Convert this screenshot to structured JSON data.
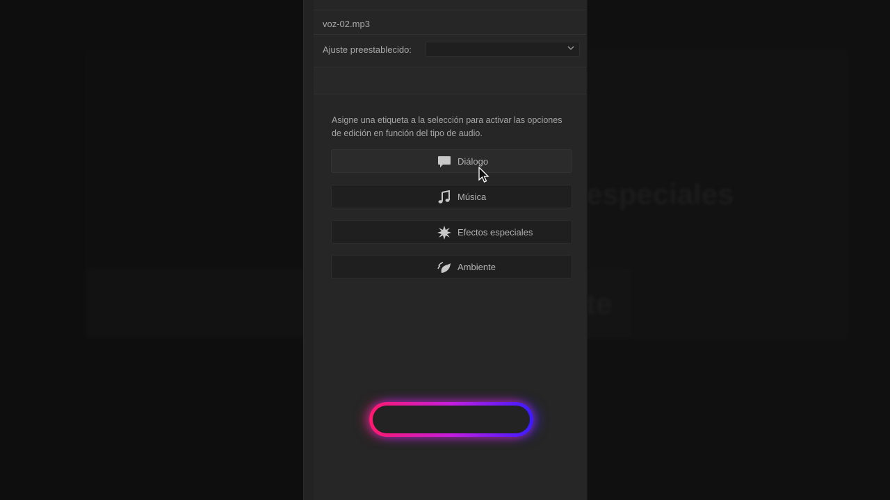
{
  "background": {
    "text_one": "especiales",
    "text_two": "te"
  },
  "panel": {
    "clip_name": "voz-02.mp3",
    "preset_label": "Ajuste preestablecido:",
    "preset_value": "",
    "hint": "Asigne una etiqueta a la selección para activar las opciones de edición en función del tipo de audio.",
    "buttons": [
      {
        "label": "Diálogo",
        "icon": "speech-bubble-icon"
      },
      {
        "label": "Música",
        "icon": "music-note-icon"
      },
      {
        "label": "Efectos especiales",
        "icon": "burst-icon"
      },
      {
        "label": "Ambiente",
        "icon": "leaf-ambient-icon"
      }
    ]
  },
  "colors": {
    "neon_left": "#ff1a6b",
    "neon_mid": "#c51de0",
    "neon_right": "#3a1cff",
    "panel_bg": "#262626"
  }
}
